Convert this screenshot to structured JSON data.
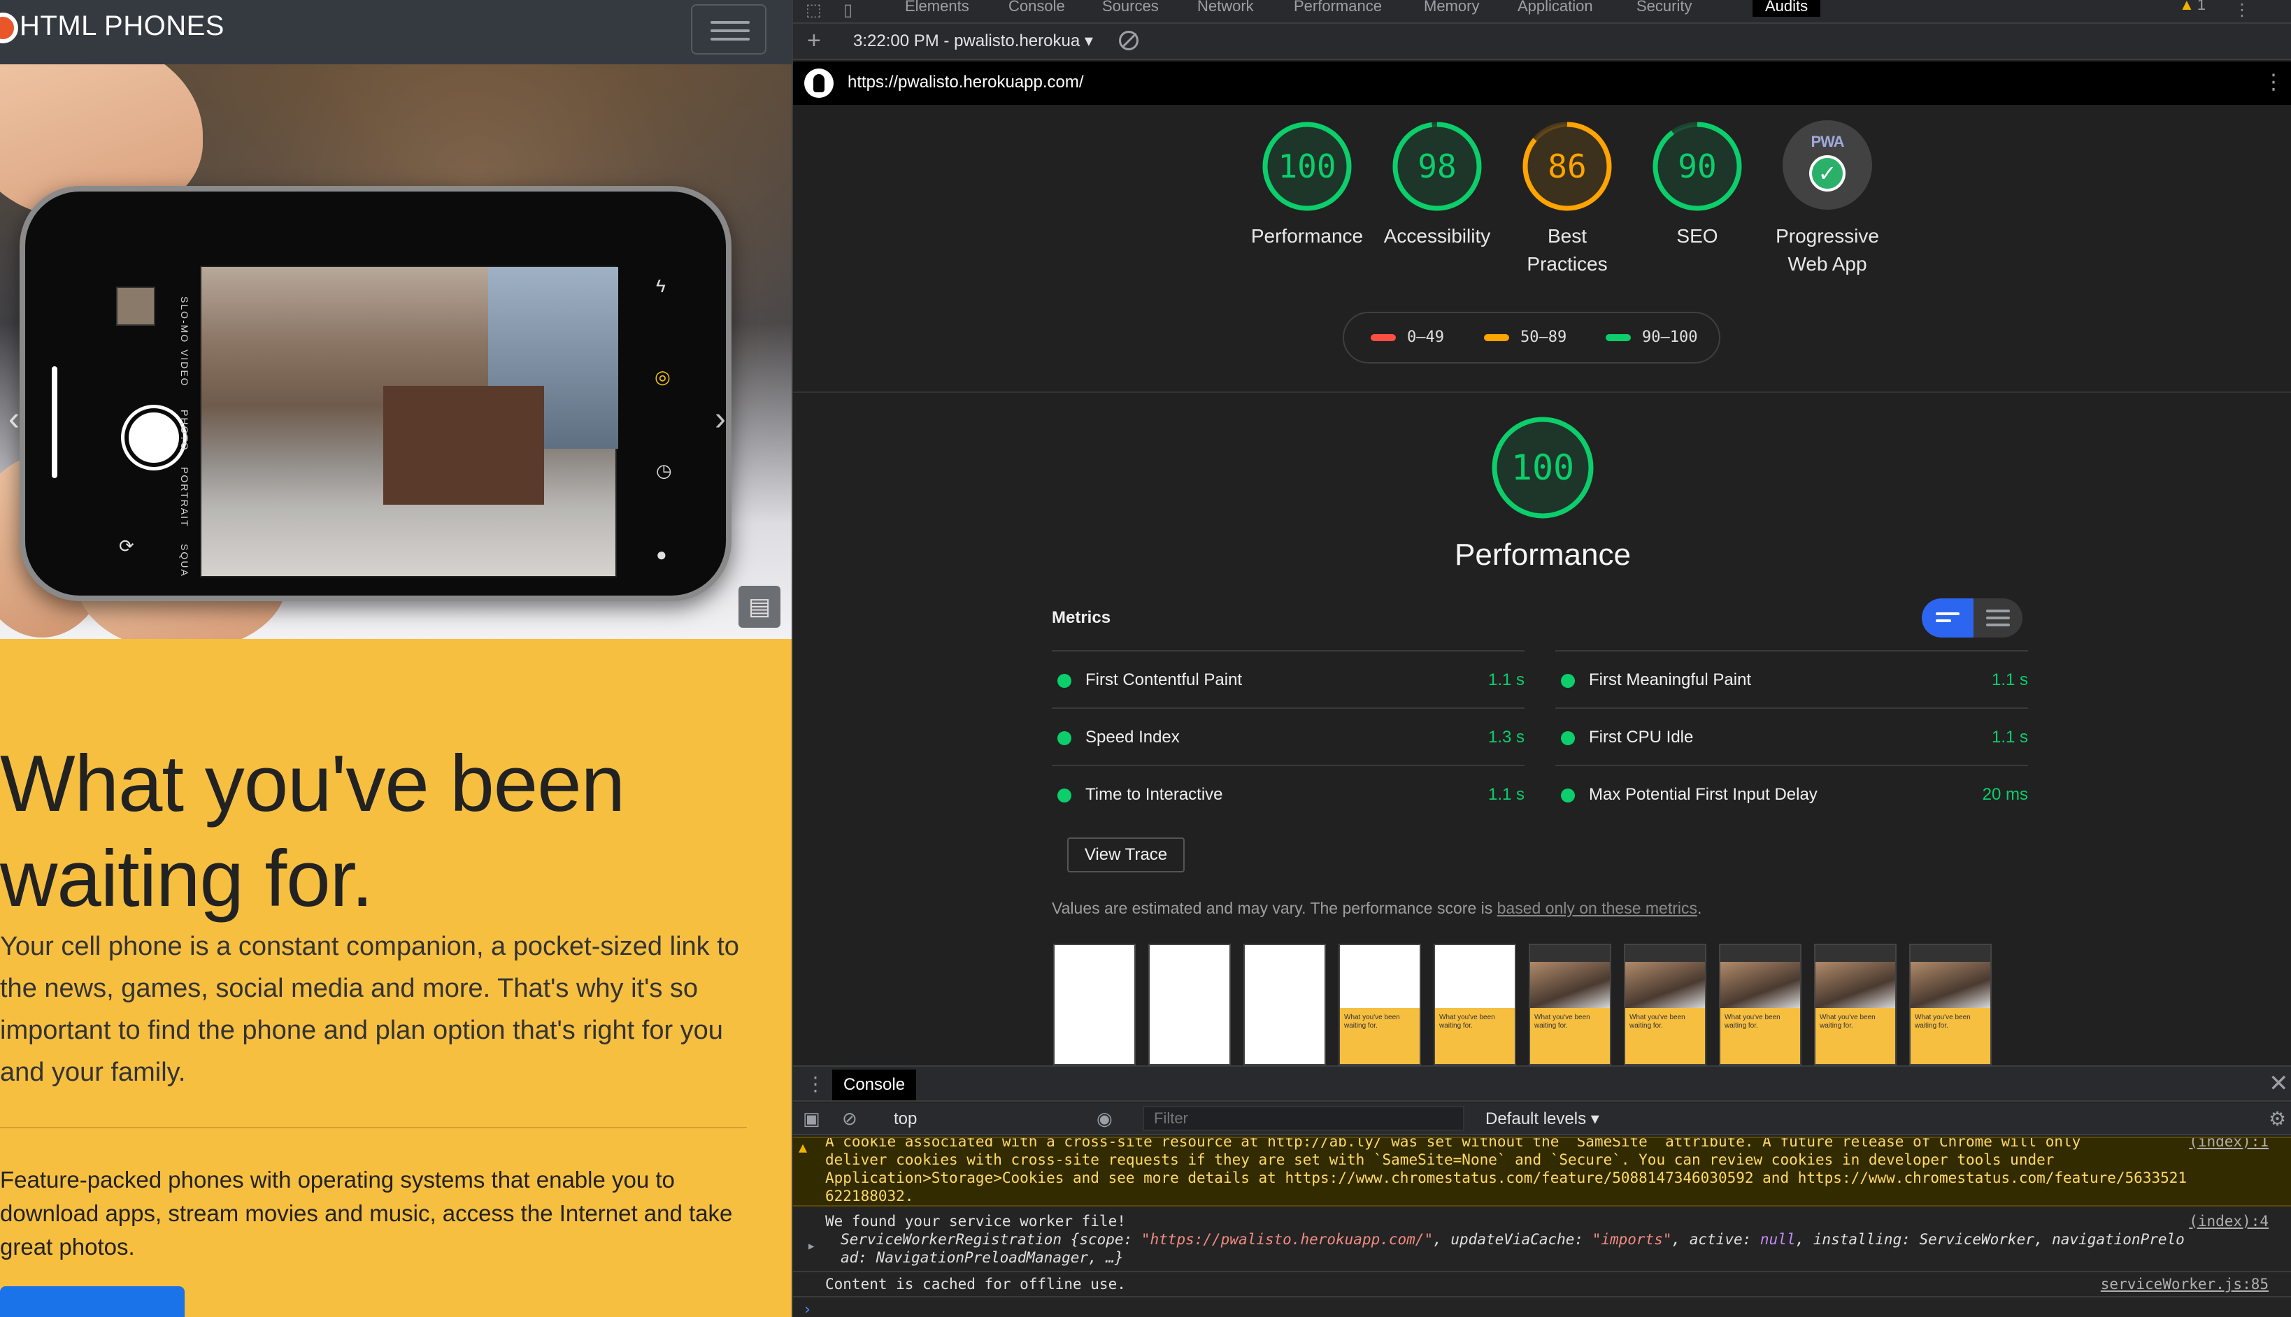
{
  "site": {
    "brand": "HTML PHONES",
    "heading": "What you've been waiting for.",
    "lead": "Your cell phone is a constant companion, a pocket-sized link to the news, games, social media and more. That's why it's so important to find the phone and plan option that's right for you and your family.",
    "feature": "Feature-packed phones with operating systems that enable you to download apps, stream movies and music, access the Internet and take great photos.",
    "camera_modes": [
      "SLO-MO",
      "VIDEO",
      "PHOTO",
      "PORTRAIT",
      "SQUA"
    ],
    "colors": {
      "background": "#f7bf40",
      "nav": "#343a40",
      "cta": "#1a73e8"
    }
  },
  "devtools": {
    "tabs": [
      "Elements",
      "Console",
      "Sources",
      "Network",
      "Performance",
      "Memory",
      "Application",
      "Security",
      "Audits"
    ],
    "active_tab": "Audits",
    "warning_count": "1",
    "audit_select": "3:22:00 PM - pwalisto.herokua",
    "url": "https://pwalisto.herokuapp.com/"
  },
  "report": {
    "categories": [
      {
        "label": "Performance",
        "score": 100,
        "color": "#0cce6b"
      },
      {
        "label": "Accessibility",
        "score": 98,
        "color": "#0cce6b"
      },
      {
        "label": "Best Practices",
        "score": 86,
        "color": "#ffa400"
      },
      {
        "label": "SEO",
        "score": 90,
        "color": "#0cce6b"
      }
    ],
    "pwa": {
      "label": "Progressive Web App",
      "badge": "PWA"
    },
    "legend": [
      {
        "range": "0–49",
        "color": "#ff4e42"
      },
      {
        "range": "50–89",
        "color": "#ffa400"
      },
      {
        "range": "90–100",
        "color": "#0cce6b"
      }
    ],
    "performance": {
      "score": 100,
      "title": "Performance",
      "metrics_title": "Metrics",
      "metrics_left": [
        {
          "name": "First Contentful Paint",
          "value": "1.1 s"
        },
        {
          "name": "Speed Index",
          "value": "1.3 s"
        },
        {
          "name": "Time to Interactive",
          "value": "1.1 s"
        }
      ],
      "metrics_right": [
        {
          "name": "First Meaningful Paint",
          "value": "1.1 s"
        },
        {
          "name": "First CPU Idle",
          "value": "1.1 s"
        },
        {
          "name": "Max Potential First Input Delay",
          "value": "20 ms"
        }
      ],
      "view_trace": "View Trace",
      "note_prefix": "Values are estimated and may vary. The performance score is ",
      "note_link": "based only on these metrics",
      "note_suffix": ".",
      "filmstrip_frames": [
        "blank",
        "blank",
        "blank",
        "text",
        "text",
        "full",
        "full",
        "full",
        "full",
        "full"
      ],
      "frame_caption": "What you've been waiting for."
    }
  },
  "console": {
    "tab": "Console",
    "context": "top",
    "filter_placeholder": "Filter",
    "levels": "Default levels ▾",
    "warn_lines": [
      "A cookie associated with a cross-site resource at http://ab.ly/ was set without the `SameSite` attribute. A future release of Chrome will only",
      "deliver cookies with cross-site requests if they are set with `SameSite=None` and `Secure`. You can review cookies in developer tools under",
      "Application>Storage>Cookies and see more details at https://www.chromestatus.com/feature/5088147346030592 and https://www.chromestatus.com/feature/5633521",
      "622188032."
    ],
    "warn_source": "(index):1",
    "sw_found": "We found your service worker file!",
    "sw_source": "(index):4",
    "sw_obj_1_prefix": "ServiceWorkerRegistration {scope: ",
    "sw_scope": "\"https://pwalisto.herokuapp.com/\"",
    "sw_mid": ", updateViaCache: ",
    "sw_cache": "\"imports\"",
    "sw_mid2": ", active: ",
    "sw_null": "null",
    "sw_tail": ", installing: ServiceWorker, navigationPrelo",
    "sw_obj_2": "ad: NavigationPreloadManager, …}",
    "cache_msg": "Content is cached for offline use.",
    "cache_source": "serviceWorker.js:85"
  }
}
